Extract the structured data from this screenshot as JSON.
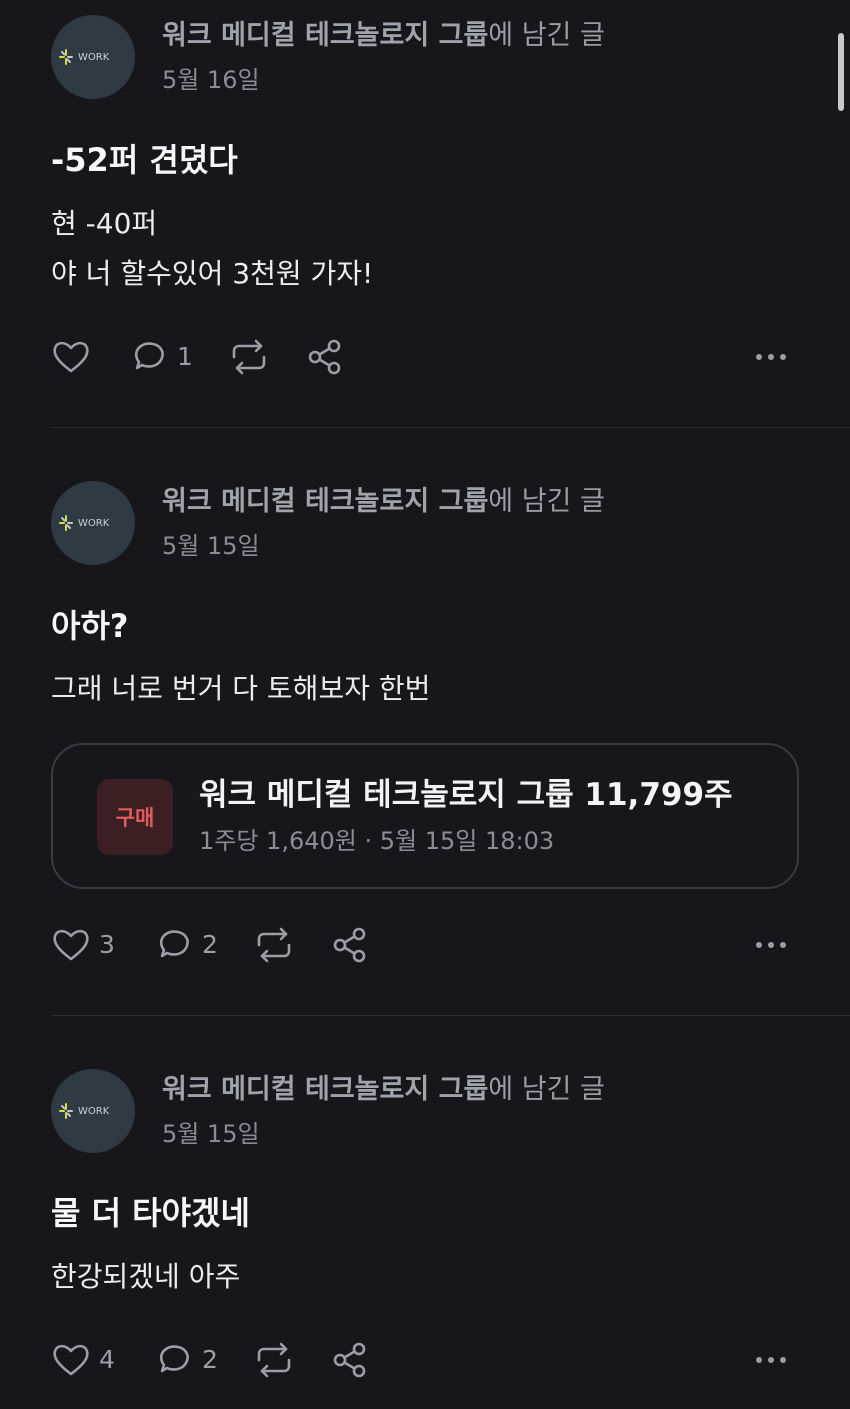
{
  "posts": [
    {
      "group_name": "워크 메디컬 테크놀로지 그룹",
      "suffix": "에 남긴 글",
      "avatar_text": "WORK",
      "date": "5월 16일",
      "title": "-52퍼 견뎠다",
      "lines": [
        "현 -40퍼",
        "야 너 할수있어 3천원 가자!"
      ],
      "likes": "",
      "comments": "1"
    },
    {
      "group_name": "워크 메디컬 테크놀로지 그룹",
      "suffix": "에 남긴 글",
      "avatar_text": "WORK",
      "date": "5월 15일",
      "title": "아하?",
      "lines": [
        "그래 너로 번거 다 토해보자 한번"
      ],
      "trade": {
        "badge": "구매",
        "title": "워크 메디컬 테크놀로지 그룹 11,799주",
        "detail": "1주당 1,640원 · 5월 15일 18:03"
      },
      "likes": "3",
      "comments": "2"
    },
    {
      "group_name": "워크 메디컬 테크놀로지 그룹",
      "suffix": "에 남긴 글",
      "avatar_text": "WORK",
      "date": "5월 15일",
      "title": "물 더 타야겠네",
      "lines": [
        "한강되겠네 아주"
      ],
      "likes": "4",
      "comments": "2"
    }
  ],
  "icons": {
    "like": "heart-icon",
    "comment": "comment-icon",
    "repost": "repost-icon",
    "share": "share-icon",
    "more": "more-icon"
  },
  "colors": {
    "background": "#17171b",
    "buy_badge_bg": "#3b1f23",
    "buy_badge_text": "#e25b5e"
  }
}
